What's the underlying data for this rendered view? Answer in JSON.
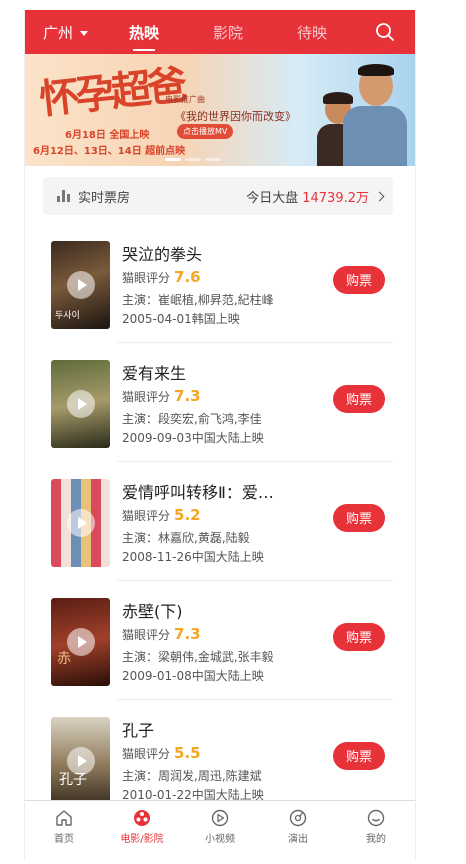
{
  "header": {
    "city": "广州",
    "tabs": [
      "热映",
      "影院",
      "待映"
    ],
    "active_tab": "热映"
  },
  "banner": {
    "title_art": "怀孕超爸",
    "subtitle": "电影推广曲",
    "song": "《我的世界因你而改变》",
    "mv_button": "点击播放MV",
    "release_date": "6月18日 全国上映",
    "preview_dates": "6月12日、13日、14日 超前点映"
  },
  "box_office": {
    "label": "实时票房",
    "today_label": "今日大盘",
    "amount": "14739.2万"
  },
  "movies": [
    {
      "title": "哭泣的拳头",
      "score_label": "猫眼评分",
      "score": "7.6",
      "actors": "主演：崔岷植,柳昇范,紀柱峰",
      "release": "2005-04-01韩国上映",
      "buy": "购票"
    },
    {
      "title": "爱有来生",
      "score_label": "猫眼评分",
      "score": "7.3",
      "actors": "主演：段奕宏,俞飞鸿,李佳",
      "release": "2009-09-03中国大陆上映",
      "buy": "购票"
    },
    {
      "title": "爱情呼叫转移Ⅱ：爱…",
      "score_label": "猫眼评分",
      "score": "5.2",
      "actors": "主演：林嘉欣,黄磊,陆毅",
      "release": "2008-11-26中国大陆上映",
      "buy": "购票"
    },
    {
      "title": "赤壁(下)",
      "score_label": "猫眼评分",
      "score": "7.3",
      "actors": "主演：梁朝伟,金城武,张丰毅",
      "release": "2009-01-08中国大陆上映",
      "buy": "购票"
    },
    {
      "title": "孔子",
      "score_label": "猫眼评分",
      "score": "5.5",
      "actors": "主演：周润发,周迅,陈建斌",
      "release": "2010-01-22中国大陆上映",
      "buy": "购票"
    }
  ],
  "bottom_nav": [
    {
      "label": "首页",
      "icon": "home-icon"
    },
    {
      "label": "电影/影院",
      "icon": "film-reel-icon"
    },
    {
      "label": "小视频",
      "icon": "play-video-icon"
    },
    {
      "label": "演出",
      "icon": "ticket-icon"
    },
    {
      "label": "我的",
      "icon": "smile-face-icon"
    }
  ],
  "active_nav": "电影/影院",
  "colors": {
    "brand_red": "#e8323a",
    "score_orange": "#f5a623"
  }
}
